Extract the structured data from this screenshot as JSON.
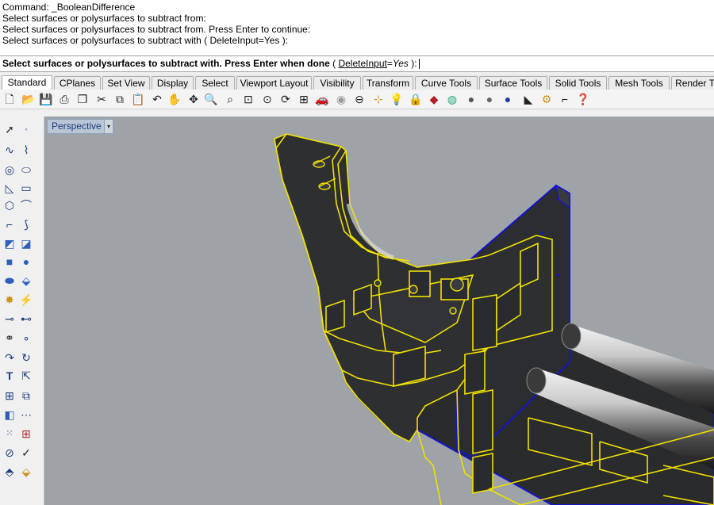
{
  "command_history": [
    "Command: _BooleanDifference",
    "Select surfaces or polysurfaces to subtract from:",
    "Select surfaces or polysurfaces to subtract from. Press Enter to continue:",
    "Select surfaces or polysurfaces to subtract with ( DeleteInput=Yes ):"
  ],
  "prompt": {
    "main": "Select surfaces or polysurfaces to subtract with. Press Enter when done",
    "open": " ( ",
    "option_name": "DeleteInput",
    "option_sep": "=",
    "option_value": "Yes",
    "close": " ):"
  },
  "tabs": [
    "Standard",
    "CPlanes",
    "Set View",
    "Display",
    "Select",
    "Viewport Layout",
    "Visibility",
    "Transform",
    "Curve Tools",
    "Surface Tools",
    "Solid Tools",
    "Mesh Tools",
    "Render T"
  ],
  "toolbar_icons": [
    "new-icon",
    "open-icon",
    "save-icon",
    "print-icon",
    "import-icon",
    "cut-icon",
    "copy-icon",
    "paste-icon",
    "undo-icon",
    "pan-icon",
    "rotate-view-icon",
    "zoom-icon",
    "zoom-window-icon",
    "zoom-extents-icon",
    "zoom-selected-icon",
    "rotate-icon",
    "four-view-icon",
    "car-icon",
    "mouse-icon",
    "hide-icon",
    "named-cplane-icon",
    "light-bulb-icon",
    "lock-icon",
    "layer-icon",
    "color-wheel-icon",
    "rendered-sphere-icon",
    "shaded-sphere-icon",
    "render-sphere-icon",
    "analyze-icon",
    "gear-options-icon",
    "snap-icon",
    "help-icon"
  ],
  "sidebar_icons": [
    "select-arrow-icon",
    "point-icon",
    "polyline-icon",
    "curve-icon",
    "circle-icon",
    "ellipse-icon",
    "arc-icon",
    "rectangle-icon",
    "polygon-icon",
    "freeform-icon",
    "fillet-curve-icon",
    "offset-curve-icon",
    "surface-corner-icon",
    "surface-edge-icon",
    "box-solid-icon",
    "sphere-solid-icon",
    "cylinder-solid-icon",
    "extrude-icon",
    "explode-icon",
    "trim-icon",
    "split-icon",
    "join-icon",
    "boolean-union-icon",
    "boolean-difference-icon",
    "move-icon",
    "copy-object-icon",
    "text-icon",
    "dimension-icon",
    "array-icon",
    "mirror-icon",
    "block-icon",
    "distance-icon",
    "point-grid-icon",
    "group-icon",
    "mesh-icon",
    "check-icon",
    "analysis-icon",
    "paint-icon"
  ],
  "viewport": {
    "label": "Perspective",
    "dropdown": "▾",
    "background": "#9ea3a8",
    "model_highlight": "#f0e000",
    "model_edges": "#1414c8"
  }
}
